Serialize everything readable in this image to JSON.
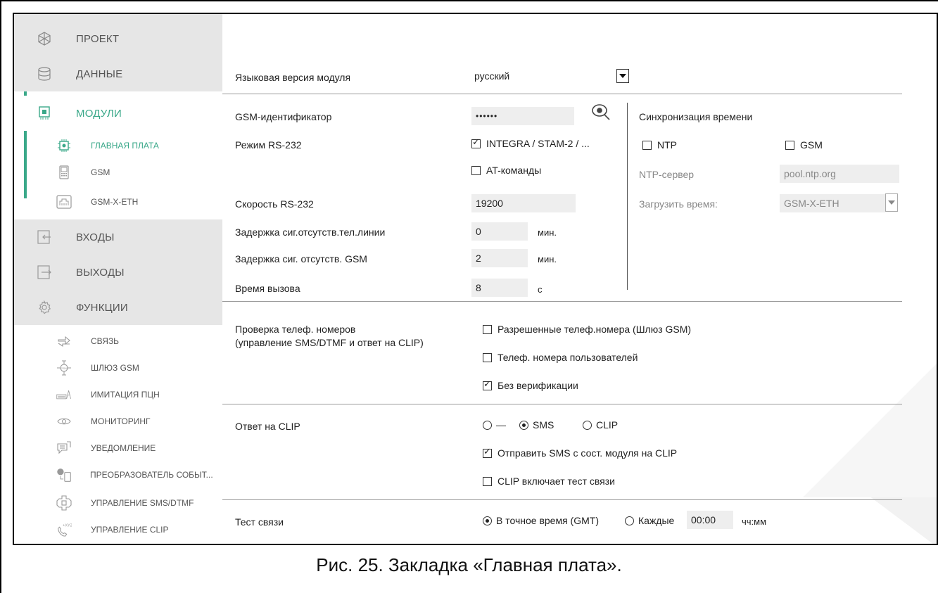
{
  "sidebar": {
    "items": [
      {
        "label": "ПРОЕКТ",
        "icon": "project-icon"
      },
      {
        "label": "ДАННЫЕ",
        "icon": "database-icon"
      },
      {
        "label": "МОДУЛИ",
        "icon": "chip-icon"
      },
      {
        "label": "ВХОДЫ",
        "icon": "input-icon"
      },
      {
        "label": "ВЫХОДЫ",
        "icon": "output-icon"
      },
      {
        "label": "ФУНКЦИИ",
        "icon": "gear-icon"
      }
    ],
    "modules_sub": [
      {
        "label": "ГЛАВНАЯ ПЛАТА",
        "icon": "mainboard-icon"
      },
      {
        "label": "GSM",
        "icon": "phone-icon"
      },
      {
        "label": "GSM-X-ETH",
        "icon": "ethernet-icon"
      }
    ],
    "functions_sub": [
      {
        "label": "СВЯЗЬ",
        "icon": "arrows-icon"
      },
      {
        "label": "ШЛЮЗ GSM",
        "icon": "gsm-gateway-icon"
      },
      {
        "label": "ИМИТАЦИЯ ПЦН",
        "icon": "station-icon"
      },
      {
        "label": "МОНИТОРИНГ",
        "icon": "eye-icon"
      },
      {
        "label": "УВЕДОМЛЕНИЕ",
        "icon": "message-icon"
      },
      {
        "label": "ПРЕОБРАЗОВАТЕЛЬ СОБЫТ...",
        "icon": "converter-icon"
      },
      {
        "label": "УПРАВЛЕНИЕ SMS/DTMF",
        "icon": "sms-control-icon"
      },
      {
        "label": "УПРАВЛЕНИЕ CLIP",
        "icon": "clip-control-icon"
      }
    ]
  },
  "main": {
    "language_label": "Языковая версия модуля",
    "language_value": "русский",
    "gsm_id_label": "GSM-идентификатор",
    "gsm_id_value": "••••••",
    "rs232_mode_label": "Режим RS-232",
    "rs232_mode_opt1": "INTEGRA / STAM-2 / ...",
    "rs232_mode_opt2": "AT-команды",
    "rs232_speed_label": "Скорость RS-232",
    "rs232_speed_value": "19200",
    "delay_line_label": "Задержка сиг.отсутств.тел.линии",
    "delay_line_value": "0",
    "delay_line_unit": "мин.",
    "delay_gsm_label": "Задержка сиг. отсутств. GSM",
    "delay_gsm_value": "2",
    "delay_gsm_unit": "мин.",
    "call_time_label": "Время вызова",
    "call_time_value": "8",
    "call_time_unit": "с",
    "sync_title": "Синхронизация времени",
    "sync_ntp": "NTP",
    "sync_gsm": "GSM",
    "ntp_server_label": "NTP-сервер",
    "ntp_server_value": "pool.ntp.org",
    "load_time_label": "Загрузить время:",
    "load_time_value": "GSM-X-ETH",
    "phone_check_label_1": "Проверка телеф. номеров",
    "phone_check_label_2": "(управление SMS/DTMF и ответ на CLIP)",
    "phone_check_opt1": "Разрешенные телеф.номера (Шлюз GSM)",
    "phone_check_opt2": "Телеф. номера пользователей",
    "phone_check_opt3": "Без верификации",
    "clip_answer_label": "Ответ на CLIP",
    "clip_opt_none": "—",
    "clip_opt_sms": "SMS",
    "clip_opt_clip": "CLIP",
    "clip_send_sms": "Отправить SMS с сост. модуля на CLIP",
    "clip_test": "CLIP включает тест связи",
    "test_label": "Тест связи",
    "test_opt1": "В точное время (GMT)",
    "test_opt2": "Каждые",
    "test_time_value": "00:00",
    "test_time_unit": "чч:мм"
  },
  "caption": "Рис. 25. Закладка «Главная плата».",
  "colors": {
    "accent": "#3aa889",
    "sidebar_bg": "#e6e6e6",
    "field_bg": "#eeeeee"
  }
}
